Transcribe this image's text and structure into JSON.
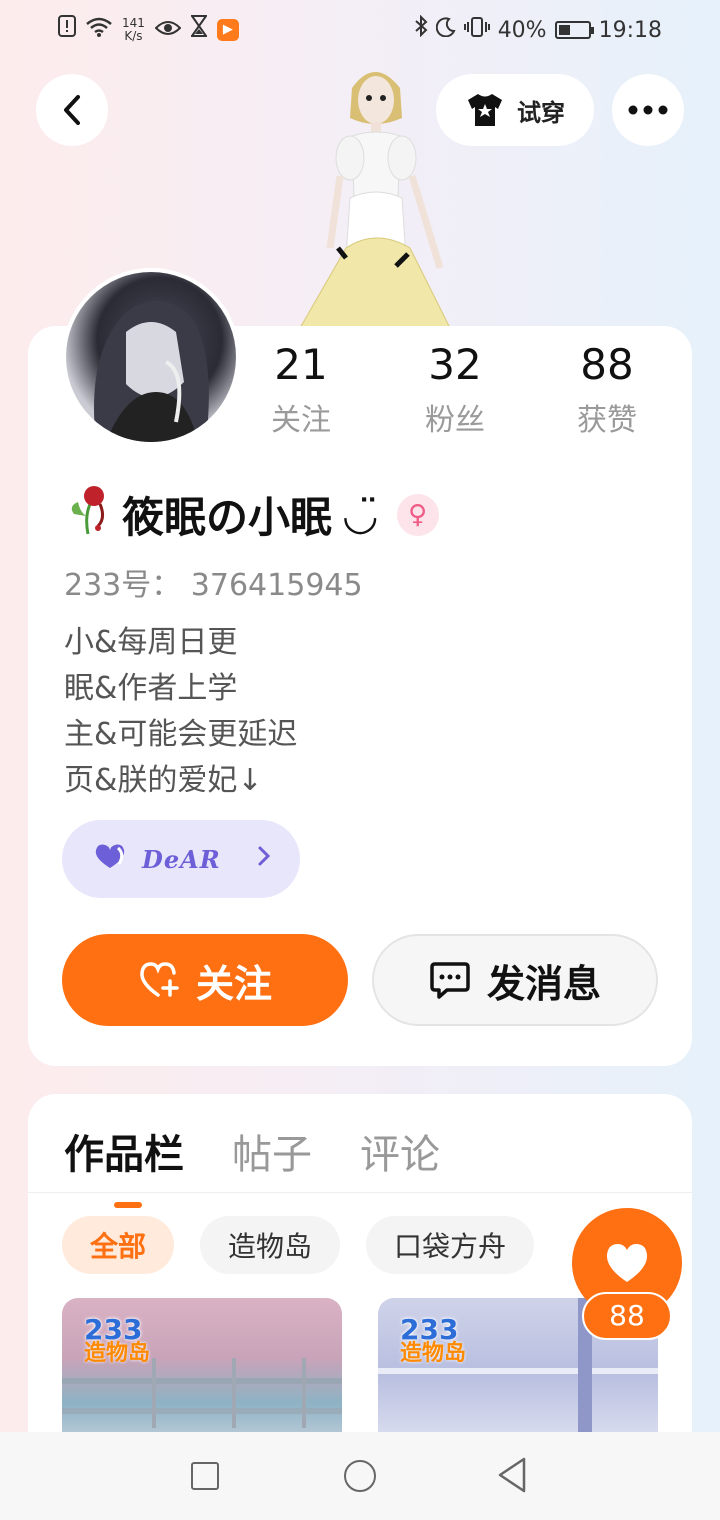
{
  "status_bar": {
    "net_speed_value": "141",
    "net_speed_unit": "K/s",
    "battery": "40%",
    "battery_level": 0.4,
    "time": "19:18"
  },
  "header": {
    "try_on_label": "试穿"
  },
  "profile": {
    "stats": [
      {
        "value": "21",
        "label": "关注"
      },
      {
        "value": "32",
        "label": "粉丝"
      },
      {
        "value": "88",
        "label": "获赞"
      }
    ],
    "name": "筱眠の小眠",
    "name_suffix": "◡̈",
    "gender_symbol": "♀",
    "uid": "233号：  376415945",
    "bio": [
      "小&每周日更",
      "眠&作者上学",
      "主&可能会更延迟",
      "页&朕的爱妃↓"
    ],
    "dear_chip": "DeAR",
    "follow_label": "关注",
    "message_label": "发消息"
  },
  "content": {
    "tabs": [
      "作品栏",
      "帖子",
      "评论"
    ],
    "active_tab": 0,
    "filters": [
      "全部",
      "造物岛",
      "口袋方舟"
    ],
    "active_filter": 0,
    "thumbs": [
      {
        "logo_top": "233",
        "logo_bottom": "造物岛"
      },
      {
        "logo_top": "233",
        "logo_bottom": "造物岛"
      }
    ]
  },
  "like": {
    "count": "88"
  },
  "colors": {
    "accent": "#ff7013",
    "dear_chip_bg": "#e8e6fb",
    "dear_chip_fg": "#6c5fd7"
  }
}
